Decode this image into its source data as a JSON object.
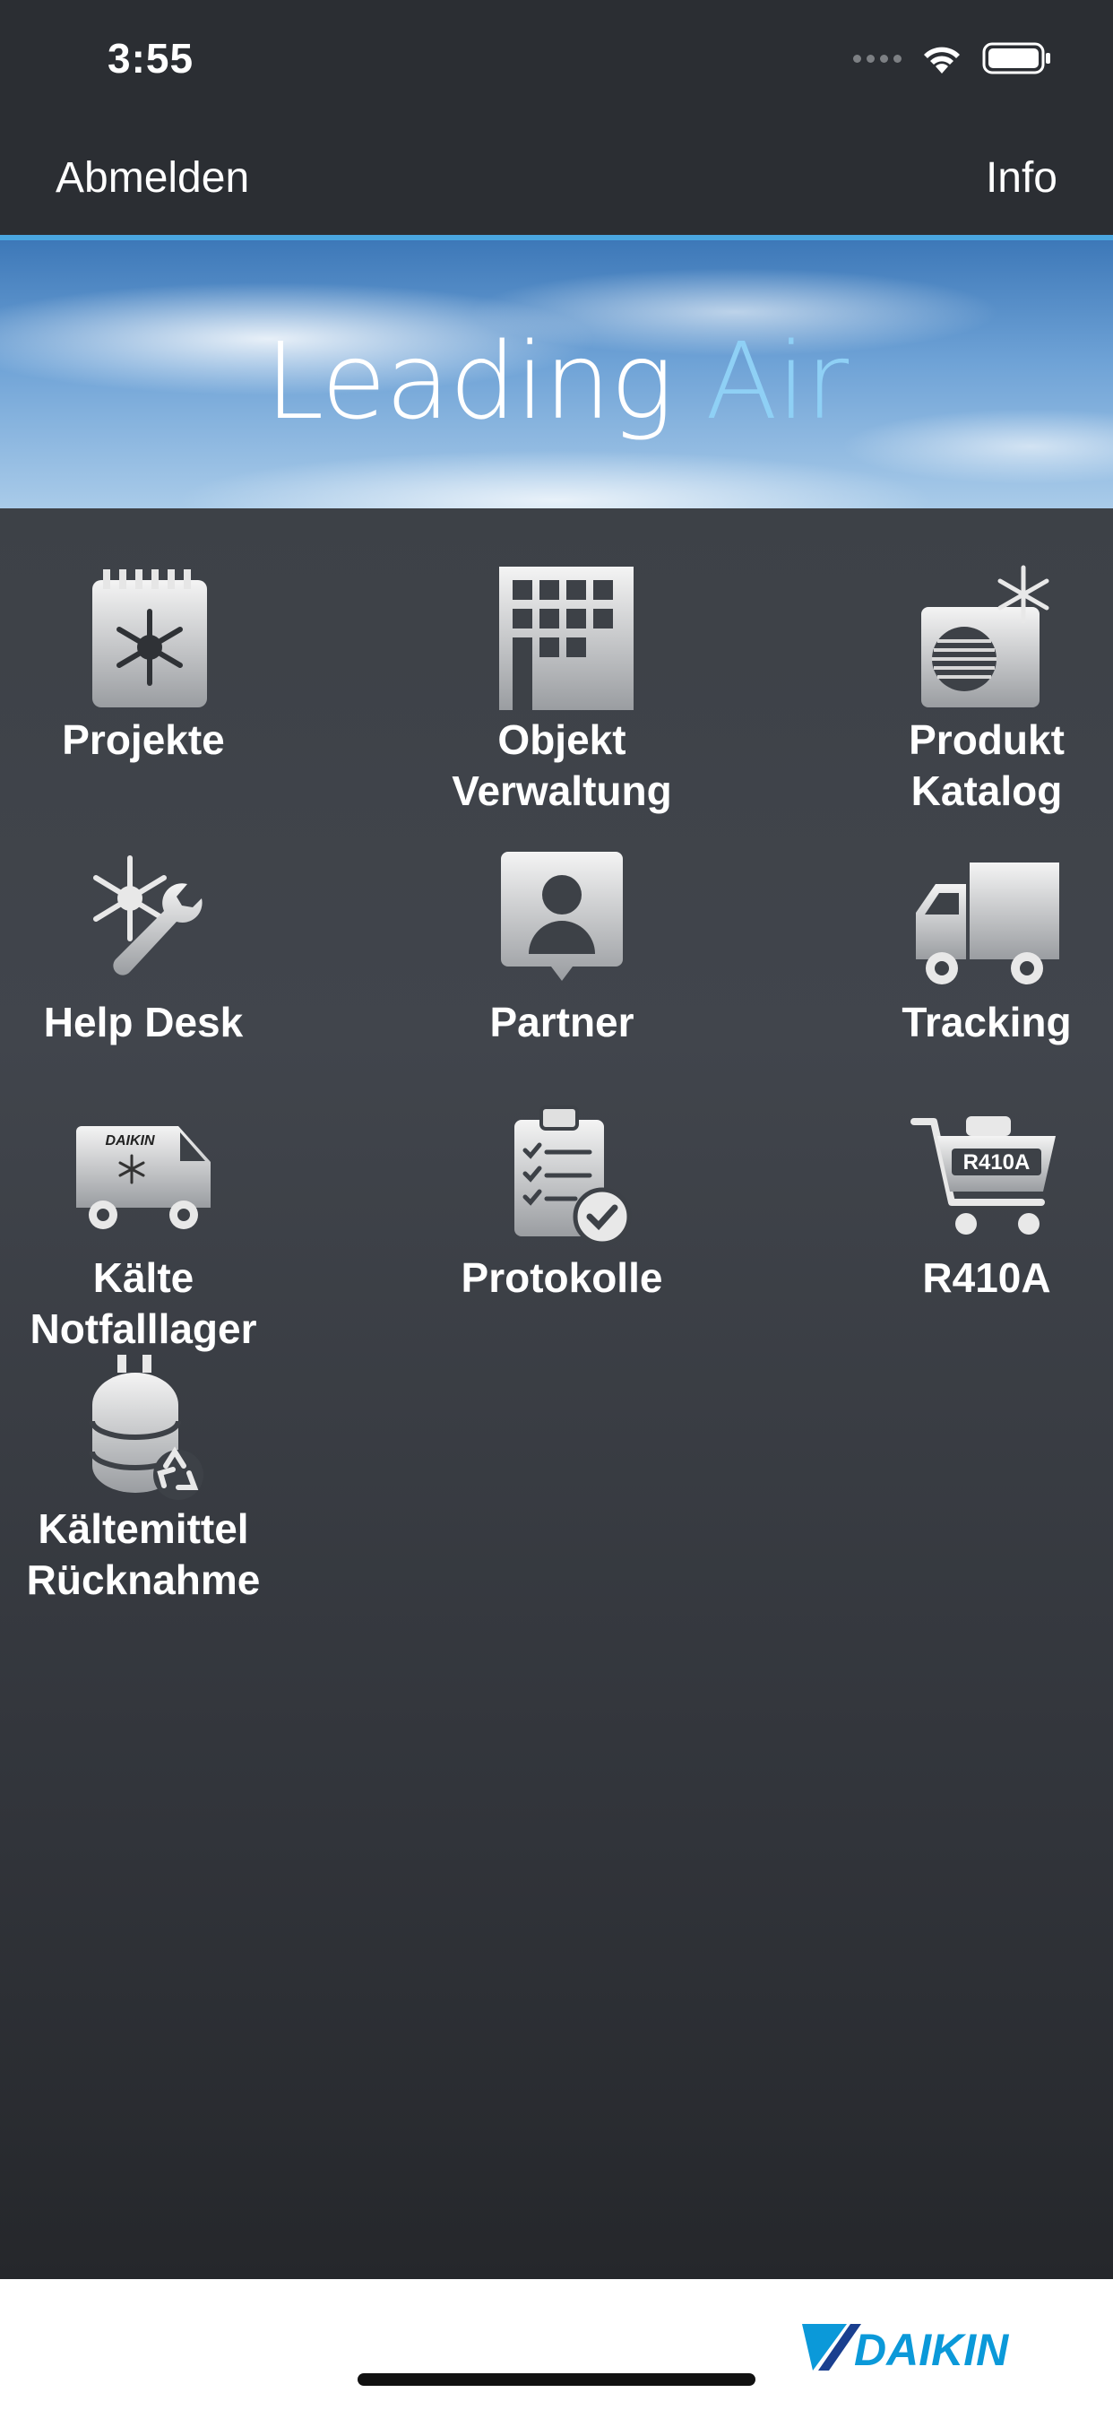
{
  "status_bar": {
    "time": "3:55"
  },
  "nav": {
    "left_button": "Abmelden",
    "right_button": "Info"
  },
  "banner": {
    "word1": "Leading",
    "word2": "Air"
  },
  "tiles": [
    {
      "label": "Projekte",
      "icon": "calendar-snowflake-icon"
    },
    {
      "label": "Objekt\nVerwaltung",
      "icon": "building-icon"
    },
    {
      "label": "Produkt\nKatalog",
      "icon": "outdoor-unit-icon"
    },
    {
      "label": "Help Desk",
      "icon": "snowflake-wrench-icon"
    },
    {
      "label": "Partner",
      "icon": "person-icon"
    },
    {
      "label": "Tracking",
      "icon": "truck-icon"
    },
    {
      "label": "Kälte\nNotfalllager",
      "icon": "daikin-van-icon"
    },
    {
      "label": "Protokolle",
      "icon": "clipboard-check-icon"
    },
    {
      "label": "R410A",
      "icon": "cart-r410a-icon"
    },
    {
      "label": "Kältemittel\nRücknahme",
      "icon": "gas-cylinder-recycle-icon"
    }
  ],
  "van_logo_text": "DAIKIN",
  "cart_text": "R410A",
  "footer": {
    "logo_text": "DAIKIN"
  },
  "colors": {
    "nav_bg": "#2b2e33",
    "accent_blue": "#1b8fd6",
    "logo_blue": "#0b99d9"
  }
}
